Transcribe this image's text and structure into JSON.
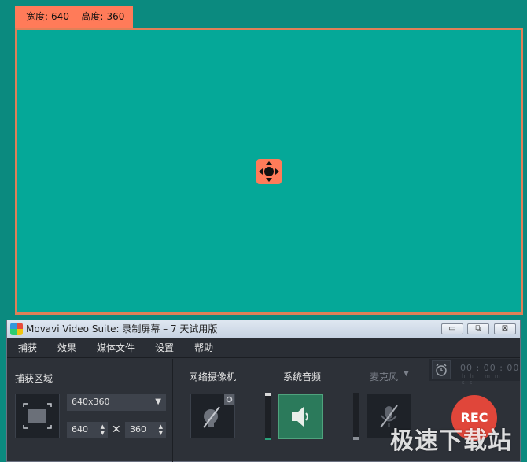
{
  "region": {
    "width_label": "宽度:",
    "width_value": "640",
    "height_label": "高度:",
    "height_value": "360"
  },
  "window": {
    "title": "Movavi Video Suite: 录制屏幕 – 7 天试用版",
    "controls": {
      "minimize": "▭",
      "restore": "⧉",
      "close": "⊠"
    }
  },
  "menu": [
    "捕获",
    "效果",
    "媒体文件",
    "设置",
    "帮助"
  ],
  "capture_area": {
    "label": "捕获区域",
    "preset": "640x360",
    "width": "640",
    "height": "360",
    "times": "✕"
  },
  "webcam": {
    "label": "网络摄像机",
    "enabled": false
  },
  "system_audio": {
    "label": "系统音频",
    "enabled": true
  },
  "microphone": {
    "label": "麦克风",
    "enabled": false
  },
  "timer": {
    "value": "00 : 00 : 00",
    "units": "hh mm ss"
  },
  "rec_label": "REC",
  "watermark": "极速下载站",
  "colors": {
    "accent": "#ff7b59",
    "region_fill": "#05a898",
    "rec": "#e0463a",
    "audio_on": "#2b7a5b"
  }
}
